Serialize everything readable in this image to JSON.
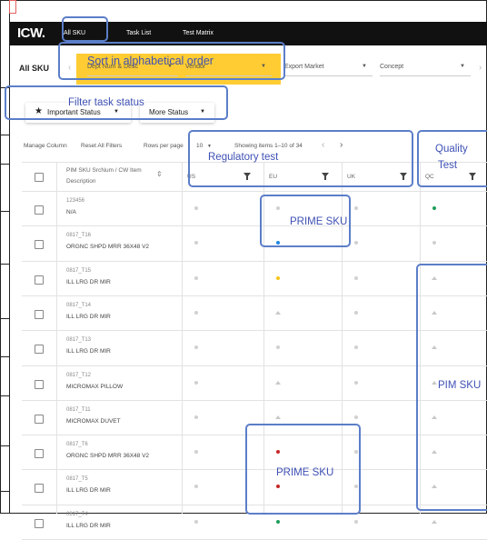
{
  "nav": {
    "logo": "ICW.",
    "items": [
      "All SKU",
      "Task List",
      "Test Matrix"
    ]
  },
  "page": {
    "title": "All SKU",
    "filters": [
      {
        "label": "Dept Num & Desc"
      },
      {
        "label": "Vendor"
      },
      {
        "label": "Export Market"
      },
      {
        "label": "Concept"
      }
    ]
  },
  "status_buttons": {
    "important": "Important Status",
    "more": "More Status"
  },
  "toolbar": {
    "manage_column": "Manage Column",
    "reset_filters": "Reset All Filters",
    "rows_per_page_label": "Rows per page",
    "rows_per_page_value": "10",
    "showing": "Showing items 1–10 of 34"
  },
  "table": {
    "headers": {
      "sku_line1": "PIM SKU SrcNum / CW Item",
      "sku_line2": "Description",
      "us": "US",
      "eu": "EU",
      "uk": "UK",
      "qc": "QC"
    },
    "rows": [
      {
        "sku": "123456",
        "desc": "N/A",
        "us": "dot-grey",
        "eu": "dot-grey",
        "uk": "dot-grey",
        "qc": "dot-green"
      },
      {
        "sku": "0817_T16",
        "desc": "ORGNC SHPD MRR 36X48 V2",
        "us": "dot-grey",
        "eu": "dot-blue",
        "uk": "dot-grey",
        "qc": "dot-grey"
      },
      {
        "sku": "0817_T15",
        "desc": "ILL LRG DR MIR",
        "us": "dot-grey",
        "eu": "dot-yellow",
        "uk": "dot-grey",
        "qc": "triangle"
      },
      {
        "sku": "0817_T14",
        "desc": "ILL LRG DR MIR",
        "us": "dot-grey",
        "eu": "triangle",
        "uk": "dot-grey",
        "qc": "triangle"
      },
      {
        "sku": "0817_T13",
        "desc": "ILL LRG DR MIR",
        "us": "dot-grey",
        "eu": "dot-grey",
        "uk": "dot-grey",
        "qc": "triangle"
      },
      {
        "sku": "0817_T12",
        "desc": "MICROMAX PILLOW",
        "us": "dot-grey",
        "eu": "triangle",
        "uk": "dot-grey",
        "qc": "triangle"
      },
      {
        "sku": "0817_T11",
        "desc": "MICROMAX DUVET",
        "us": "dot-grey",
        "eu": "triangle",
        "uk": "dot-grey",
        "qc": "triangle"
      },
      {
        "sku": "0817_T6",
        "desc": "ORGNC SHPD MRR 36X48 V2",
        "us": "dot-grey",
        "eu": "dot-red",
        "uk": "dot-grey",
        "qc": "triangle"
      },
      {
        "sku": "0817_T5",
        "desc": "ILL LRG DR MIR",
        "us": "dot-grey",
        "eu": "dot-red",
        "uk": "dot-grey",
        "qc": "triangle"
      },
      {
        "sku": "0817_T4",
        "desc": "ILL LRG DR MIR",
        "us": "dot-grey",
        "eu": "dot-green",
        "uk": "dot-grey",
        "qc": "triangle"
      }
    ]
  },
  "status_colors": {
    "dot-grey": "#d0d0d0",
    "dot-green": "#1e9e5a",
    "dot-blue": "#1e88e5",
    "dot-yellow": "#f5c518",
    "dot-red": "#c62828"
  },
  "annotations": {
    "sort": "Sort in alphabetical order",
    "filter_status": "Filter task status",
    "regulatory": "Regulatory test",
    "quality_line1": "Quality",
    "quality_line2": "Test",
    "prime_sku_top": "PRIME SKU",
    "prime_sku_bottom": "PRIME SKU",
    "pim_sku": "PIM SKU"
  }
}
